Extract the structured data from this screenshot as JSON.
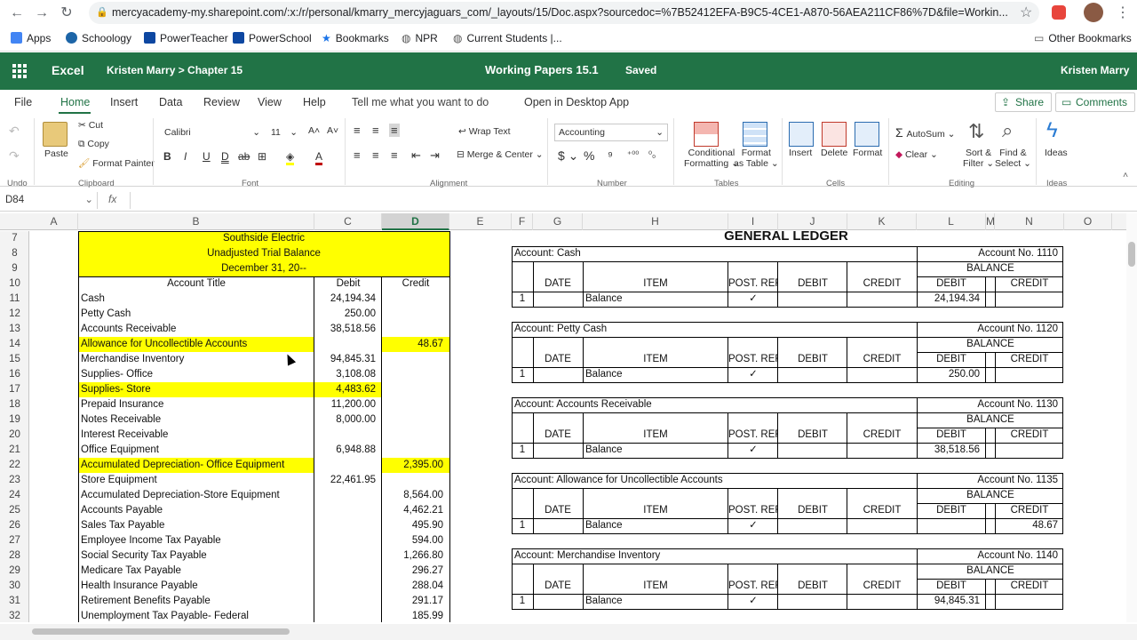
{
  "browser": {
    "url": "mercyacademy-my.sharepoint.com/:x:/r/personal/kmarry_mercyjaguars_com/_layouts/15/Doc.aspx?sourcedoc=%7B52412EFA-B9C5-4CE1-A870-56AEA211CF86%7D&file=Workin..."
  },
  "bookmarks": [
    "Apps",
    "Schoology",
    "PowerTeacher",
    "PowerSchool",
    "Bookmarks",
    "NPR",
    "Current Students |...",
    "Other Bookmarks"
  ],
  "suite": {
    "app": "Excel",
    "crumb": "Kristen Marry  >  Chapter 15",
    "title": "Working Papers 15.1",
    "status": "Saved",
    "user": "Kristen Marry"
  },
  "menus": {
    "file": "File",
    "home": "Home",
    "insert": "Insert",
    "data": "Data",
    "review": "Review",
    "view": "View",
    "help": "Help",
    "tellme": "Tell me what you want to do",
    "desktop": "Open in Desktop App",
    "share": "Share",
    "comments": "Comments"
  },
  "ribbon": {
    "undo": "Undo",
    "paste": "Paste",
    "cut": "Cut",
    "copy": "Copy",
    "format_painter": "Format Painter",
    "clipboard": "Clipboard",
    "font_name": "Calibri",
    "font_size": "11",
    "font": "Font",
    "wrap": "Wrap Text",
    "merge": "Merge & Center",
    "alignment": "Alignment",
    "number_format": "Accounting",
    "number": "Number",
    "cond": "Conditional",
    "cond2": "Formatting",
    "fmt_table": "Format",
    "fmt_table2": "as Table",
    "tables": "Tables",
    "insert": "Insert",
    "delete": "Delete",
    "format": "Format",
    "cells": "Cells",
    "autosum": "AutoSum",
    "clear": "Clear",
    "sort": "Sort &",
    "sort2": "Filter",
    "find": "Find &",
    "find2": "Select",
    "editing": "Editing",
    "ideas": "Ideas",
    "ideas_grp": "Ideas"
  },
  "formula_bar": {
    "name_box": "D84",
    "fx": "fx",
    "formula": ""
  },
  "columns": [
    "A",
    "B",
    "C",
    "D",
    "E",
    "F",
    "G",
    "H",
    "I",
    "J",
    "K",
    "L",
    "M",
    "N",
    "O"
  ],
  "rows": [
    "7",
    "8",
    "9",
    "10",
    "11",
    "12",
    "13",
    "14",
    "15",
    "16",
    "17",
    "18",
    "19",
    "20",
    "21",
    "22",
    "23",
    "24",
    "25",
    "26",
    "27",
    "28",
    "29",
    "30",
    "31",
    "32"
  ],
  "trial_balance": {
    "headers": [
      "Southside Electric",
      "Unadjusted Trial Balance",
      "December 31, 20--"
    ],
    "col_titles": [
      "Account Title",
      "Debit",
      "Credit"
    ],
    "accounts": [
      {
        "title": "Cash",
        "debit": "24,194.34",
        "credit": ""
      },
      {
        "title": "Petty Cash",
        "debit": "250.00",
        "credit": ""
      },
      {
        "title": "Accounts Receivable",
        "debit": "38,518.56",
        "credit": ""
      },
      {
        "title": "Allowance for Uncollectible Accounts",
        "debit": "",
        "credit": "48.67"
      },
      {
        "title": "Merchandise Inventory",
        "debit": "94,845.31",
        "credit": ""
      },
      {
        "title": "Supplies- Office",
        "debit": "3,108.08",
        "credit": ""
      },
      {
        "title": "Supplies- Store",
        "debit": "4,483.62",
        "credit": ""
      },
      {
        "title": "Prepaid Insurance",
        "debit": "11,200.00",
        "credit": ""
      },
      {
        "title": "Notes Receivable",
        "debit": "8,000.00",
        "credit": ""
      },
      {
        "title": "Interest Receivable",
        "debit": "",
        "credit": ""
      },
      {
        "title": "Office Equipment",
        "debit": "6,948.88",
        "credit": ""
      },
      {
        "title": "Accumulated Depreciation- Office Equipment",
        "debit": "",
        "credit": "2,395.00"
      },
      {
        "title": "Store Equipment",
        "debit": "22,461.95",
        "credit": ""
      },
      {
        "title": "Accumulated Depreciation-Store Equipment",
        "debit": "",
        "credit": "8,564.00"
      },
      {
        "title": "Accounts Payable",
        "debit": "",
        "credit": "4,462.21"
      },
      {
        "title": "Sales Tax Payable",
        "debit": "",
        "credit": "495.90"
      },
      {
        "title": "Employee Income Tax Payable",
        "debit": "",
        "credit": "594.00"
      },
      {
        "title": "Social Security Tax Payable",
        "debit": "",
        "credit": "1,266.80"
      },
      {
        "title": "Medicare Tax Payable",
        "debit": "",
        "credit": "296.27"
      },
      {
        "title": "Health Insurance Payable",
        "debit": "",
        "credit": "288.04"
      },
      {
        "title": "Retirement Benefits Payable",
        "debit": "",
        "credit": "291.17"
      },
      {
        "title": "Unemployment Tax Payable- Federal",
        "debit": "",
        "credit": "185.99"
      }
    ]
  },
  "ledger": {
    "title": "GENERAL LEDGER",
    "col_titles": {
      "date": "DATE",
      "item": "ITEM",
      "post_ref": "POST. REF.",
      "debit": "DEBIT",
      "credit": "CREDIT",
      "balance": "BALANCE",
      "bal_debit": "DEBIT",
      "bal_credit": "CREDIT"
    },
    "accounts": [
      {
        "name": "Account: Cash",
        "no": "Account No. 1110",
        "day": "1",
        "item": "Balance",
        "check": "✓",
        "bal_debit": "24,194.34",
        "bal_credit": ""
      },
      {
        "name": "Account: Petty Cash",
        "no": "Account No. 1120",
        "day": "1",
        "item": "Balance",
        "check": "✓",
        "bal_debit": "250.00",
        "bal_credit": ""
      },
      {
        "name": "Account: Accounts Receivable",
        "no": "Account No.  1130",
        "day": "1",
        "item": "Balance",
        "check": "✓",
        "bal_debit": "38,518.56",
        "bal_credit": ""
      },
      {
        "name": "Account: Allowance for Uncollectible Accounts",
        "no": "Account No. 1135",
        "day": "1",
        "item": "Balance",
        "check": "✓",
        "bal_debit": "",
        "bal_credit": "48.67"
      },
      {
        "name": "Account: Merchandise Inventory",
        "no": "Account No. 1140",
        "day": "1",
        "item": "Balance",
        "check": "✓",
        "bal_debit": "94,845.31",
        "bal_credit": ""
      }
    ]
  },
  "highlight_color": "#ffff00",
  "brand_color": "#217346"
}
